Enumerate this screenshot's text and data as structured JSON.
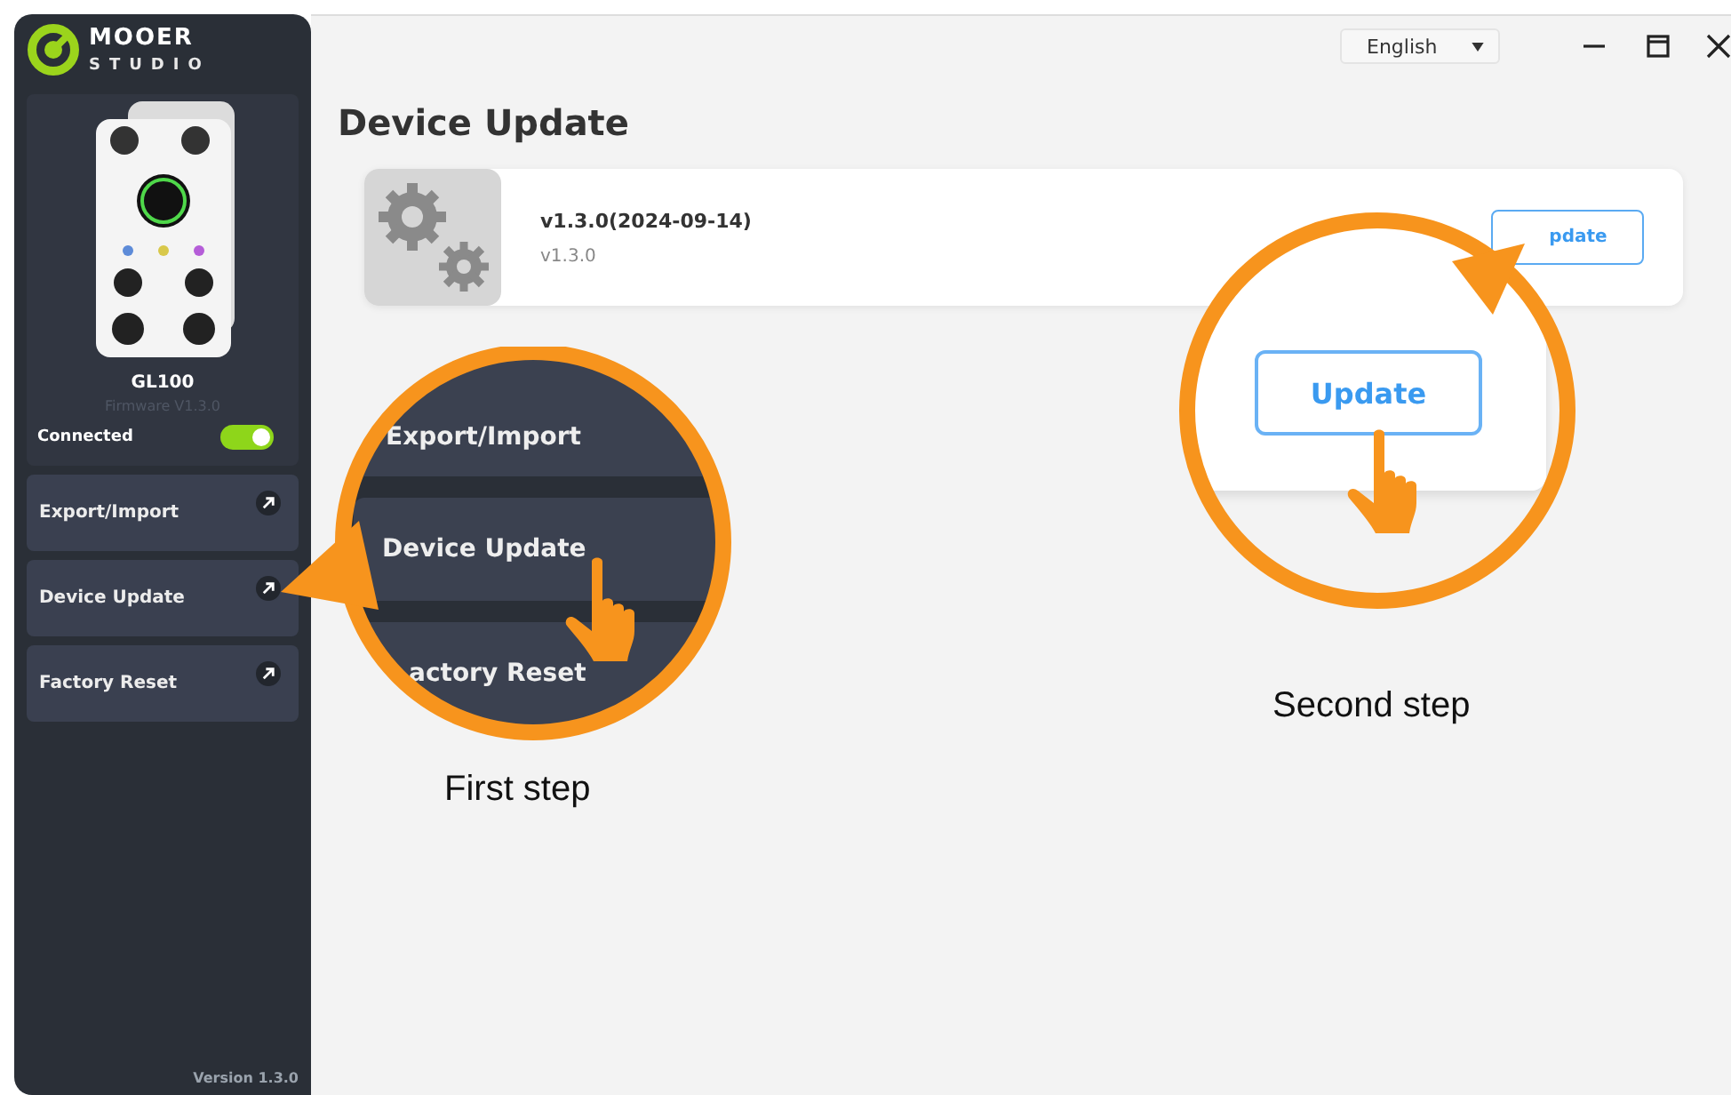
{
  "window": {
    "language": "English"
  },
  "sidebar": {
    "logo": {
      "brand": "MOOER",
      "sub": "STUDIO"
    },
    "device": {
      "name": "GL100",
      "firmware": "Firmware V1.3.0",
      "status": "Connected",
      "connected": true
    },
    "items": [
      {
        "label": "Export/Import"
      },
      {
        "label": "Device Update"
      },
      {
        "label": "Factory Reset"
      }
    ],
    "version": "Version 1.3.0"
  },
  "page": {
    "title": "Device Update",
    "update": {
      "version": "v1.3.0(2024-09-14)",
      "current": "v1.3.0",
      "button": "pdate"
    }
  },
  "callouts": [
    {
      "kind": "menu",
      "items": [
        "Export/Import",
        "Device Update",
        "actory Reset"
      ],
      "caption": "First step"
    },
    {
      "kind": "button",
      "button": "Update",
      "caption": "Second step"
    }
  ]
}
